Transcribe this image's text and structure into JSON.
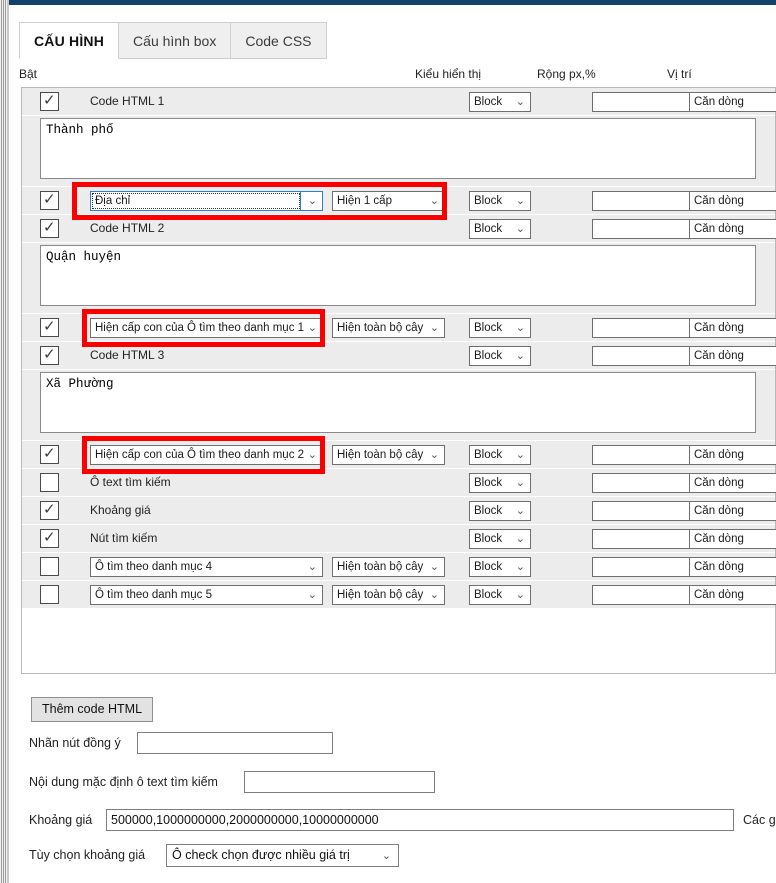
{
  "window": {
    "accent_color": "#13416b",
    "highlight_color": "#fb0000"
  },
  "tabs": [
    {
      "label": "CẤU HÌNH",
      "active": true
    },
    {
      "label": "Cấu hình box",
      "active": false
    },
    {
      "label": "Code CSS",
      "active": false
    }
  ],
  "column_headers": {
    "enable": "Bật",
    "display_type": "Kiểu hiển thị",
    "width": "Rộng px,%",
    "position": "Vị trí"
  },
  "defaults": {
    "block_label": "Block",
    "align_label": "Căn dòng",
    "width_value": "",
    "tree_label": "Hiện toàn bộ cây"
  },
  "rows": [
    {
      "type": "item",
      "checked": true,
      "label": "Code HTML 1",
      "control": "label",
      "display": "Block",
      "width": "",
      "position": "Căn dòng"
    },
    {
      "type": "textarea",
      "value": "Thành phố"
    },
    {
      "type": "item",
      "checked": true,
      "control": "two-selects",
      "source": "Địa chỉ",
      "source_focused": true,
      "level": "Hiện 1 cấp",
      "display": "Block",
      "width": "",
      "position": "Căn dòng",
      "highlighted": "full"
    },
    {
      "type": "item",
      "checked": true,
      "label": "Code HTML 2",
      "control": "label",
      "display": "Block",
      "width": "",
      "position": "Căn dòng"
    },
    {
      "type": "textarea",
      "value": "Quận huyện"
    },
    {
      "type": "item",
      "checked": true,
      "control": "two-selects",
      "source": "Hiện cấp con của Ô tìm theo danh mục 1",
      "source_focused": false,
      "level": "Hiện toàn bộ cây",
      "display": "Block",
      "width": "",
      "position": "Căn dòng",
      "highlighted": "source"
    },
    {
      "type": "item",
      "checked": true,
      "label": "Code HTML 3",
      "control": "label",
      "display": "Block",
      "width": "",
      "position": "Căn dòng"
    },
    {
      "type": "textarea",
      "value": "Xã Phường"
    },
    {
      "type": "item",
      "checked": true,
      "control": "two-selects",
      "source": "Hiện cấp con của Ô tìm theo danh mục 2",
      "source_focused": false,
      "level": "Hiện toàn bộ cây",
      "display": "Block",
      "width": "",
      "position": "Căn dòng",
      "highlighted": "source"
    },
    {
      "type": "item",
      "checked": false,
      "label": "Ô text tìm kiếm",
      "control": "label",
      "display": "Block",
      "width": "",
      "position": "Căn dòng"
    },
    {
      "type": "item",
      "checked": true,
      "label": "Khoảng giá",
      "control": "label",
      "display": "Block",
      "width": "",
      "position": "Căn dòng"
    },
    {
      "type": "item",
      "checked": true,
      "label": "Nút tìm kiếm",
      "control": "label",
      "display": "Block",
      "width": "",
      "position": "Căn dòng"
    },
    {
      "type": "item",
      "checked": false,
      "control": "two-selects",
      "source": "Ô tìm theo danh mục 4",
      "source_focused": false,
      "level": "Hiện toàn bộ cây",
      "display": "Block",
      "width": "",
      "position": "Căn dòng"
    },
    {
      "type": "item",
      "checked": false,
      "control": "two-selects",
      "source": "Ô tìm theo danh mục 5",
      "source_focused": false,
      "level": "Hiện toàn bộ cây",
      "display": "Block",
      "width": "",
      "position": "Căn dòng"
    }
  ],
  "footer": {
    "add_html_button": "Thêm code HTML",
    "agree_label": "Nhãn nút đồng ý",
    "agree_value": "",
    "search_default_label": "Nội dung mặc định ô text tìm kiếm",
    "search_default_value": "",
    "price_range_label": "Khoảng giá",
    "price_range_value": "500000,1000000000,2000000000,10000000000",
    "price_range_trailing": "Các giá t",
    "price_option_label": "Tùy chọn khoảng giá",
    "price_option_value": "Ô check chọn được nhiều giá trị"
  },
  "icons": {
    "chevron_down": "⌄",
    "check": "✓"
  }
}
